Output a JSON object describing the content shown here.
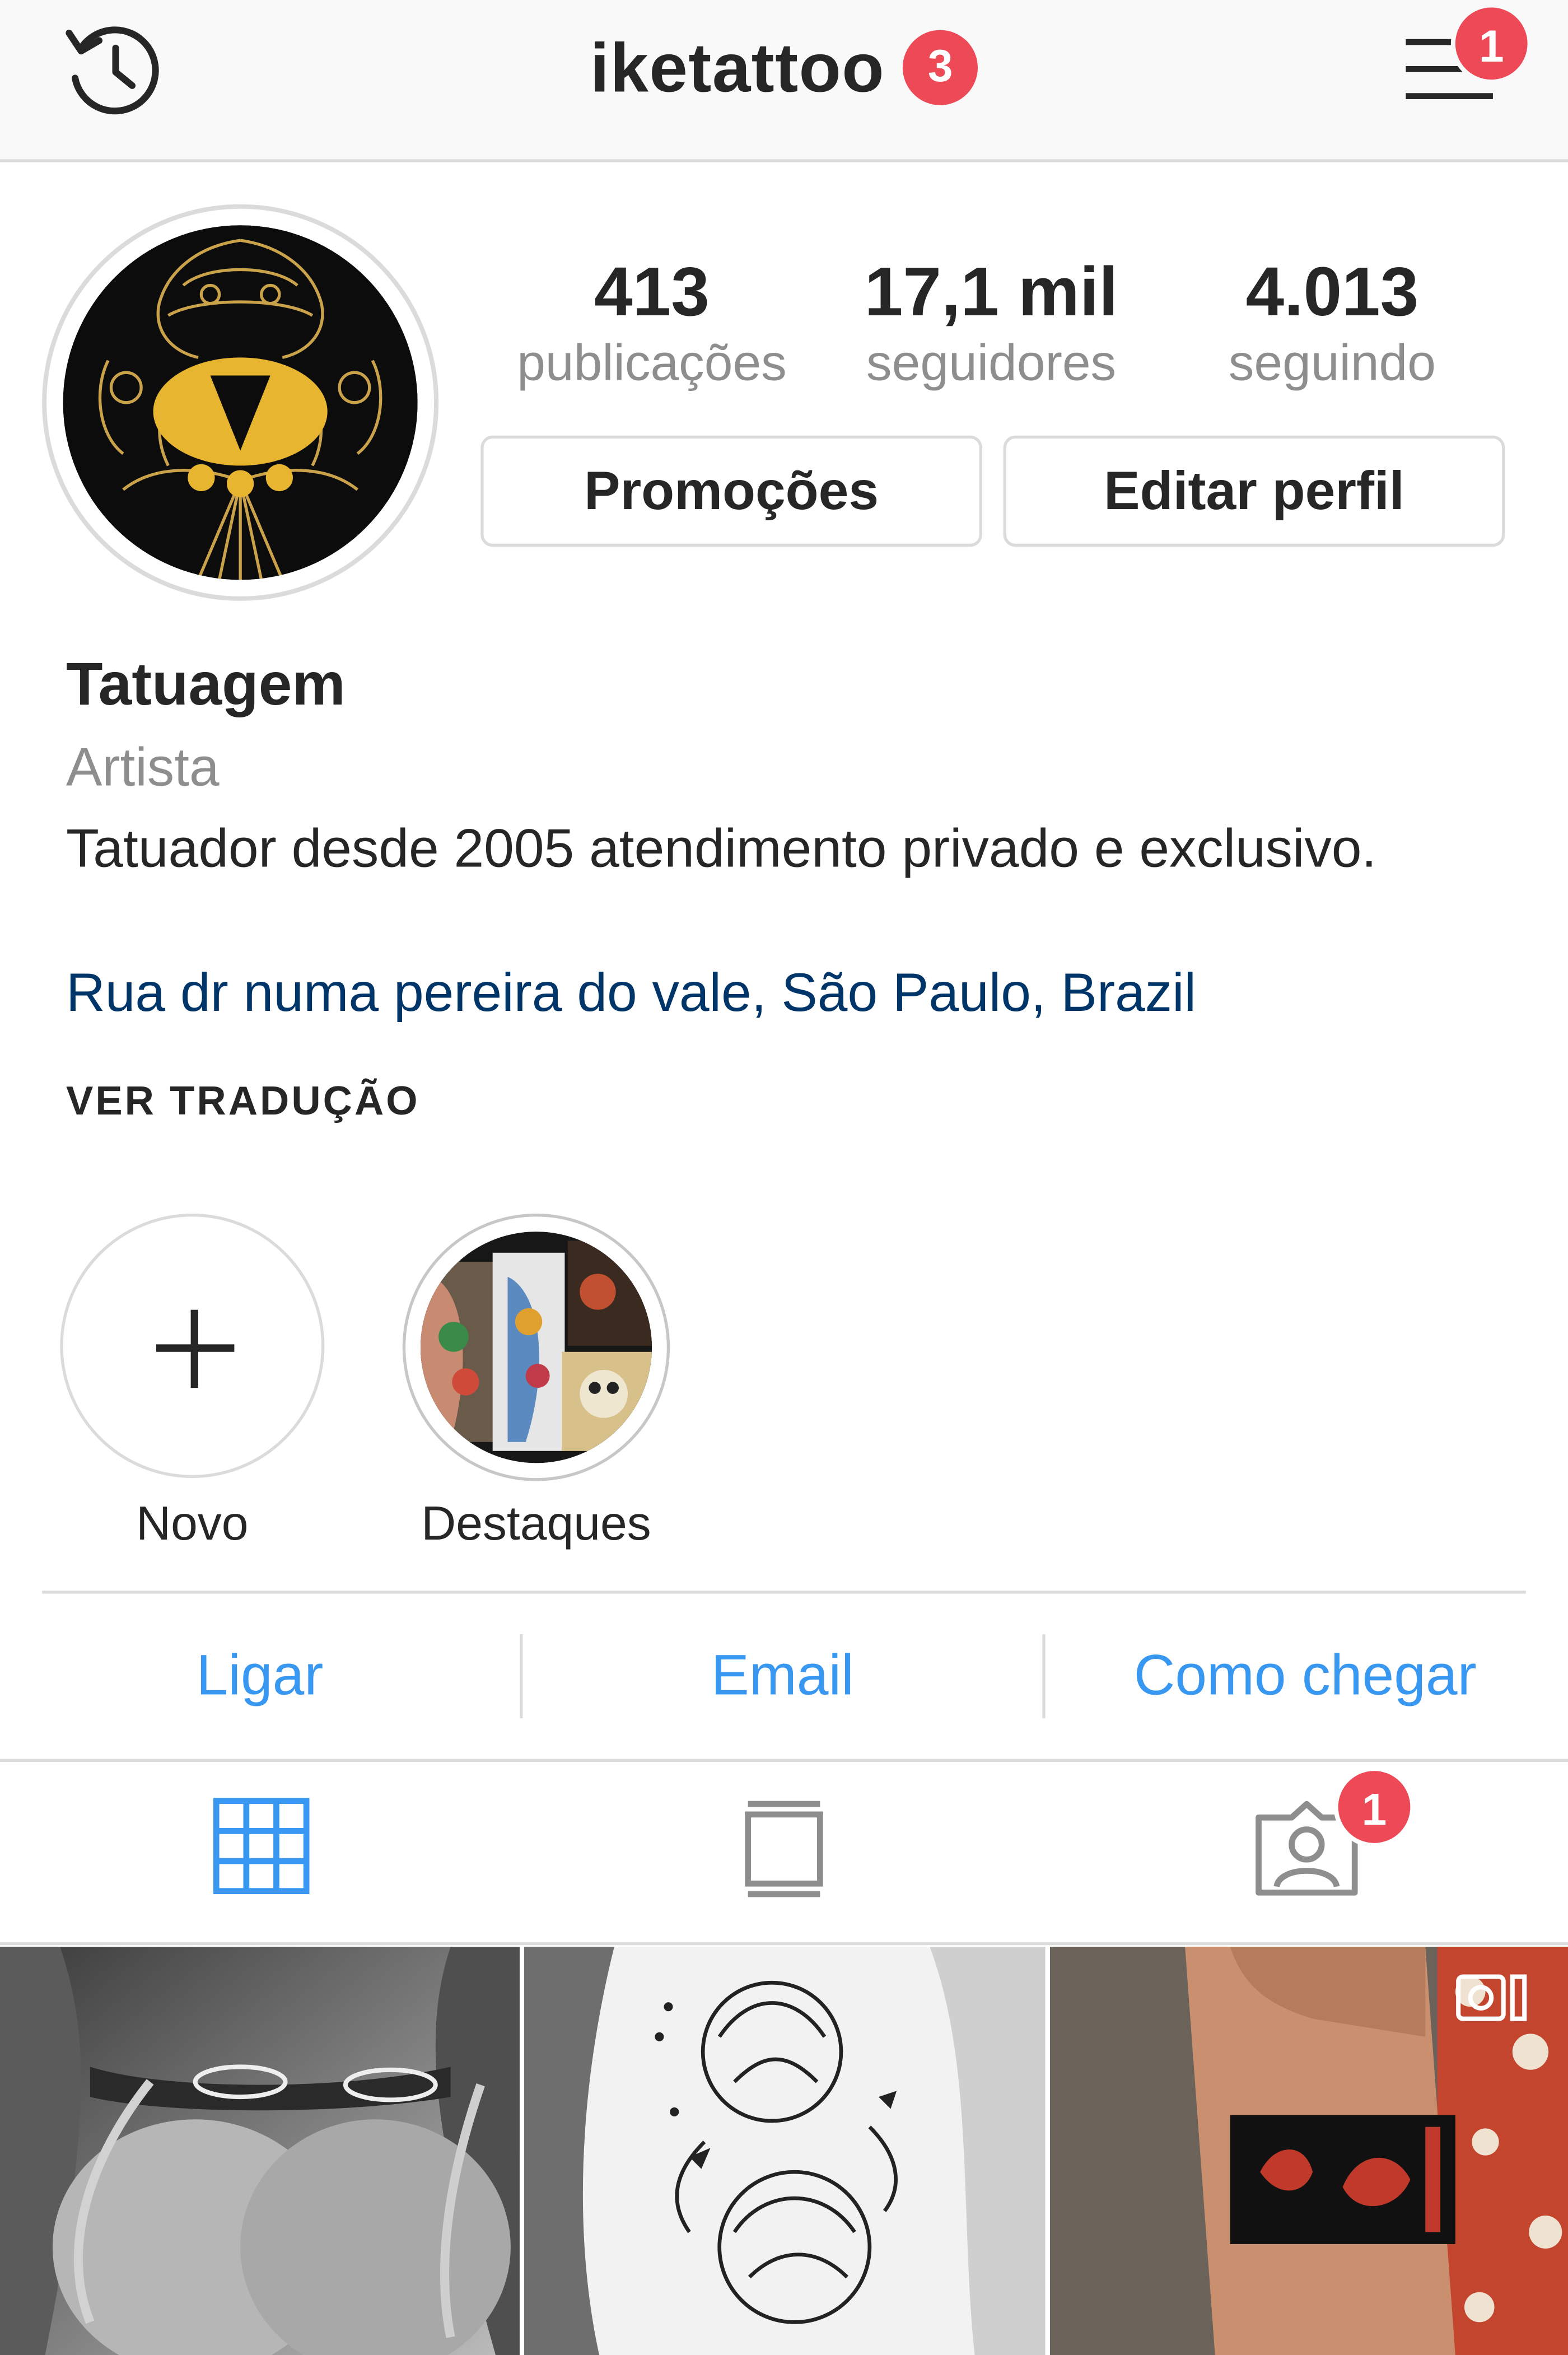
{
  "header": {
    "username": "iketattoo",
    "notification_count": "3",
    "menu_badge": "1"
  },
  "stats": [
    {
      "value": "413",
      "label": "publicações"
    },
    {
      "value": "17,1 mil",
      "label": "seguidores"
    },
    {
      "value": "4.013",
      "label": "seguindo"
    }
  ],
  "buttons": {
    "promotions": "Promoções",
    "edit_profile": "Editar perfil"
  },
  "bio": {
    "name": "Tatuagem",
    "category": "Artista",
    "text": "Tatuador desde 2005 atendimento privado e exclusivo.",
    "location": "Rua dr numa pereira do vale, São Paulo, Brazil",
    "see_translation": "VER TRADUÇÃO"
  },
  "highlights": [
    {
      "label": "Novo"
    },
    {
      "label": "Destaques"
    }
  ],
  "actions": {
    "call": "Ligar",
    "email": "Email",
    "directions": "Como chegar"
  },
  "tabs": {
    "tagged_badge": "1",
    "active": "grid"
  },
  "colors": {
    "accent_blue": "#3897f0",
    "link_dark_blue": "#003569",
    "badge_red": "#ed4956",
    "secondary_text": "#8e8e8e",
    "border": "#dbdbdb"
  }
}
